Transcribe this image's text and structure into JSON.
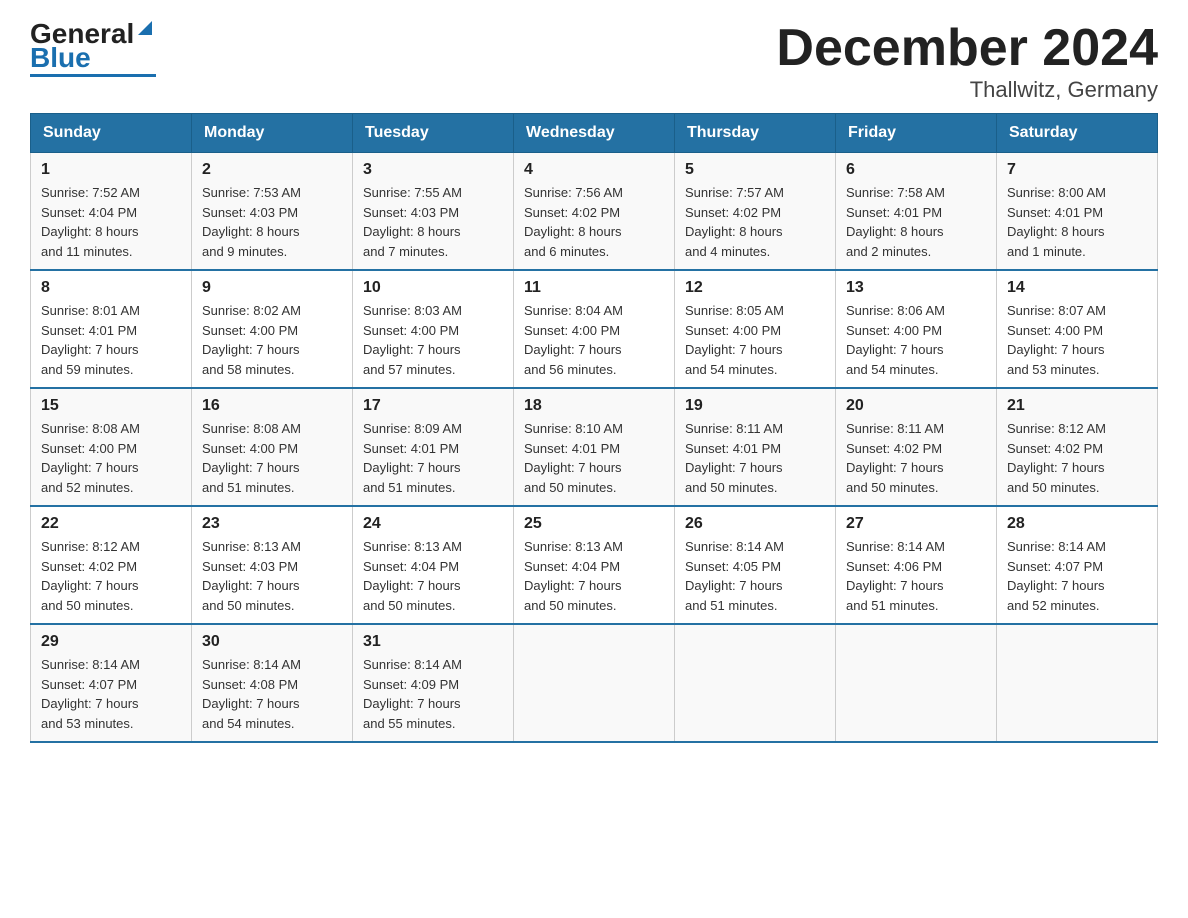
{
  "header": {
    "logo_general": "General",
    "logo_blue": "Blue",
    "title": "December 2024",
    "subtitle": "Thallwitz, Germany"
  },
  "days_of_week": [
    "Sunday",
    "Monday",
    "Tuesday",
    "Wednesday",
    "Thursday",
    "Friday",
    "Saturday"
  ],
  "weeks": [
    [
      {
        "day": "1",
        "sunrise": "7:52 AM",
        "sunset": "4:04 PM",
        "daylight": "8 hours and 11 minutes."
      },
      {
        "day": "2",
        "sunrise": "7:53 AM",
        "sunset": "4:03 PM",
        "daylight": "8 hours and 9 minutes."
      },
      {
        "day": "3",
        "sunrise": "7:55 AM",
        "sunset": "4:03 PM",
        "daylight": "8 hours and 7 minutes."
      },
      {
        "day": "4",
        "sunrise": "7:56 AM",
        "sunset": "4:02 PM",
        "daylight": "8 hours and 6 minutes."
      },
      {
        "day": "5",
        "sunrise": "7:57 AM",
        "sunset": "4:02 PM",
        "daylight": "8 hours and 4 minutes."
      },
      {
        "day": "6",
        "sunrise": "7:58 AM",
        "sunset": "4:01 PM",
        "daylight": "8 hours and 2 minutes."
      },
      {
        "day": "7",
        "sunrise": "8:00 AM",
        "sunset": "4:01 PM",
        "daylight": "8 hours and 1 minute."
      }
    ],
    [
      {
        "day": "8",
        "sunrise": "8:01 AM",
        "sunset": "4:01 PM",
        "daylight": "7 hours and 59 minutes."
      },
      {
        "day": "9",
        "sunrise": "8:02 AM",
        "sunset": "4:00 PM",
        "daylight": "7 hours and 58 minutes."
      },
      {
        "day": "10",
        "sunrise": "8:03 AM",
        "sunset": "4:00 PM",
        "daylight": "7 hours and 57 minutes."
      },
      {
        "day": "11",
        "sunrise": "8:04 AM",
        "sunset": "4:00 PM",
        "daylight": "7 hours and 56 minutes."
      },
      {
        "day": "12",
        "sunrise": "8:05 AM",
        "sunset": "4:00 PM",
        "daylight": "7 hours and 54 minutes."
      },
      {
        "day": "13",
        "sunrise": "8:06 AM",
        "sunset": "4:00 PM",
        "daylight": "7 hours and 54 minutes."
      },
      {
        "day": "14",
        "sunrise": "8:07 AM",
        "sunset": "4:00 PM",
        "daylight": "7 hours and 53 minutes."
      }
    ],
    [
      {
        "day": "15",
        "sunrise": "8:08 AM",
        "sunset": "4:00 PM",
        "daylight": "7 hours and 52 minutes."
      },
      {
        "day": "16",
        "sunrise": "8:08 AM",
        "sunset": "4:00 PM",
        "daylight": "7 hours and 51 minutes."
      },
      {
        "day": "17",
        "sunrise": "8:09 AM",
        "sunset": "4:01 PM",
        "daylight": "7 hours and 51 minutes."
      },
      {
        "day": "18",
        "sunrise": "8:10 AM",
        "sunset": "4:01 PM",
        "daylight": "7 hours and 50 minutes."
      },
      {
        "day": "19",
        "sunrise": "8:11 AM",
        "sunset": "4:01 PM",
        "daylight": "7 hours and 50 minutes."
      },
      {
        "day": "20",
        "sunrise": "8:11 AM",
        "sunset": "4:02 PM",
        "daylight": "7 hours and 50 minutes."
      },
      {
        "day": "21",
        "sunrise": "8:12 AM",
        "sunset": "4:02 PM",
        "daylight": "7 hours and 50 minutes."
      }
    ],
    [
      {
        "day": "22",
        "sunrise": "8:12 AM",
        "sunset": "4:02 PM",
        "daylight": "7 hours and 50 minutes."
      },
      {
        "day": "23",
        "sunrise": "8:13 AM",
        "sunset": "4:03 PM",
        "daylight": "7 hours and 50 minutes."
      },
      {
        "day": "24",
        "sunrise": "8:13 AM",
        "sunset": "4:04 PM",
        "daylight": "7 hours and 50 minutes."
      },
      {
        "day": "25",
        "sunrise": "8:13 AM",
        "sunset": "4:04 PM",
        "daylight": "7 hours and 50 minutes."
      },
      {
        "day": "26",
        "sunrise": "8:14 AM",
        "sunset": "4:05 PM",
        "daylight": "7 hours and 51 minutes."
      },
      {
        "day": "27",
        "sunrise": "8:14 AM",
        "sunset": "4:06 PM",
        "daylight": "7 hours and 51 minutes."
      },
      {
        "day": "28",
        "sunrise": "8:14 AM",
        "sunset": "4:07 PM",
        "daylight": "7 hours and 52 minutes."
      }
    ],
    [
      {
        "day": "29",
        "sunrise": "8:14 AM",
        "sunset": "4:07 PM",
        "daylight": "7 hours and 53 minutes."
      },
      {
        "day": "30",
        "sunrise": "8:14 AM",
        "sunset": "4:08 PM",
        "daylight": "7 hours and 54 minutes."
      },
      {
        "day": "31",
        "sunrise": "8:14 AM",
        "sunset": "4:09 PM",
        "daylight": "7 hours and 55 minutes."
      },
      null,
      null,
      null,
      null
    ]
  ],
  "labels": {
    "sunrise": "Sunrise:",
    "sunset": "Sunset:",
    "daylight": "Daylight:"
  }
}
